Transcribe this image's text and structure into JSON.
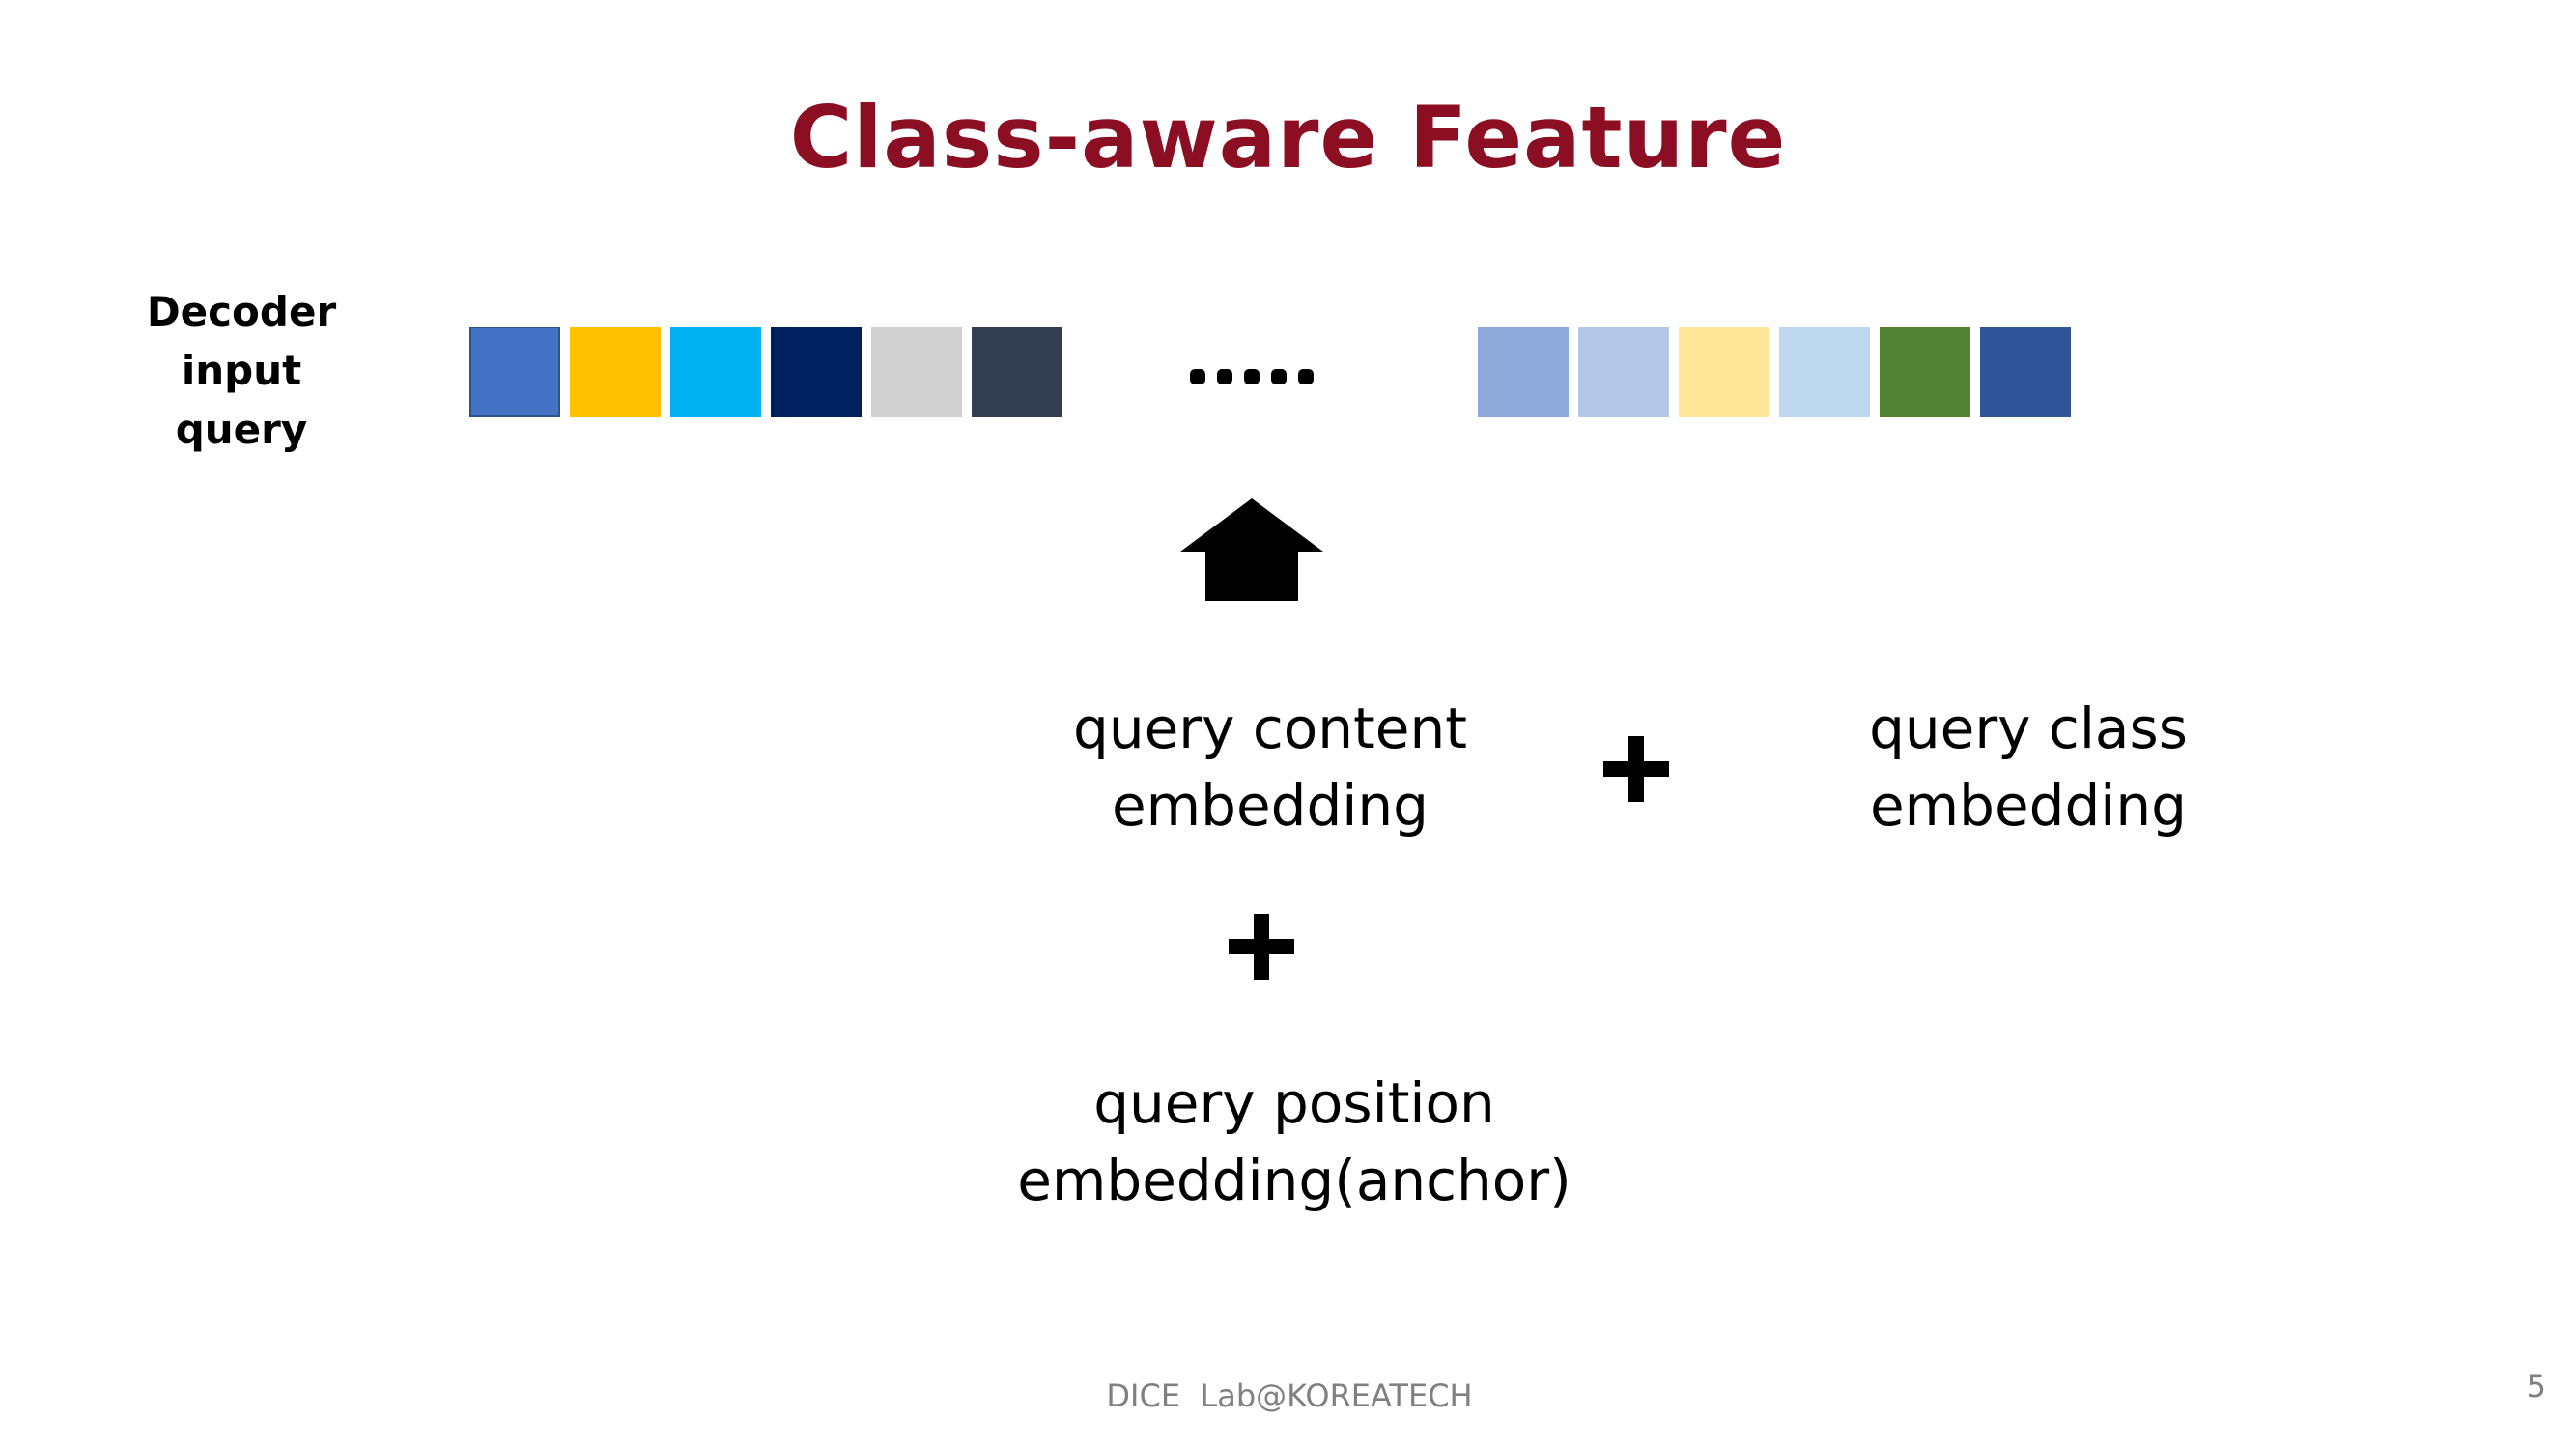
{
  "title": "Class-aware Feature",
  "colors": {
    "title": "#8b0e23",
    "text": "#000000",
    "footer": "#808080"
  },
  "decoder_label": {
    "line1": "Decoder",
    "line2": "input",
    "line3": "query"
  },
  "query_squares_left": [
    {
      "color": "#4472c4",
      "outlined": true
    },
    {
      "color": "#ffc000",
      "outlined": false
    },
    {
      "color": "#00b0f0",
      "outlined": false
    },
    {
      "color": "#002060",
      "outlined": false
    },
    {
      "color": "#d0d0d0",
      "outlined": false
    },
    {
      "color": "#333f50",
      "outlined": false
    }
  ],
  "query_squares_right": [
    {
      "color": "#8faadc",
      "outlined": false
    },
    {
      "color": "#b4c7e7",
      "outlined": false
    },
    {
      "color": "#ffe699",
      "outlined": false
    },
    {
      "color": "#bdd7ee",
      "outlined": false
    },
    {
      "color": "#548235",
      "outlined": false
    },
    {
      "color": "#2f5597",
      "outlined": false
    }
  ],
  "ellipsis_icon": "ellipsis-dots",
  "arrow_icon": "up-arrow",
  "content_embedding": {
    "line1": "query content",
    "line2": "embedding"
  },
  "class_embedding": {
    "line1": "query class",
    "line2": "embedding"
  },
  "position_embedding": {
    "line1": "query position",
    "line2": "embedding(anchor)"
  },
  "plus_icon": "plus-sign",
  "footer": "DICE  Lab@KOREATECH",
  "page_number": "5"
}
